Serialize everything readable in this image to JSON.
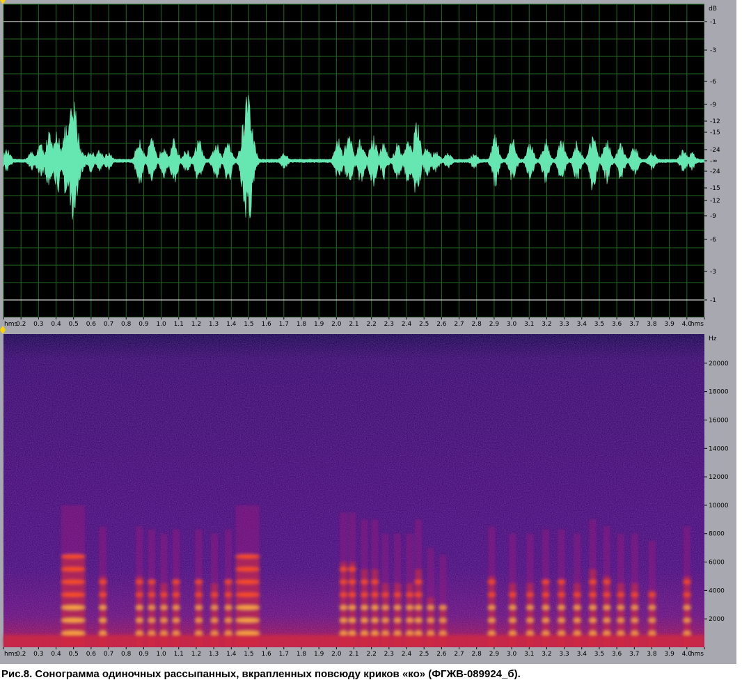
{
  "caption": "Рис.8. Сонограмма одиночных рассыпанных, вкрапленных повсюду криков «ко» (ФГЖВ-089924_б).",
  "colors": {
    "window_bg": "#a8a8b0",
    "waveform_bg": "#000000",
    "waveform_grid": "#1f6b1f",
    "waveform_line": "#66e6b0",
    "waveform_limit_line": "#ffffff",
    "ruler_bg": "#a8a8b0",
    "ruler_text": "#000000",
    "marker": "#ffd400"
  },
  "chart_data": [
    {
      "type": "line",
      "name": "waveform",
      "x_unit": "hms",
      "x_ticks": [
        "hms",
        "0.2",
        "0.3",
        "0.4",
        "0.5",
        "0.6",
        "0.7",
        "0.8",
        "0.9",
        "1.0",
        "1.1",
        "1.2",
        "1.3",
        "1.4",
        "1.5",
        "1.6",
        "1.7",
        "1.8",
        "1.9",
        "2.0",
        "2.1",
        "2.2",
        "2.3",
        "2.4",
        "2.5",
        "2.6",
        "2.7",
        "2.8",
        "2.9",
        "3.0",
        "3.1",
        "3.2",
        "3.3",
        "3.4",
        "3.5",
        "3.6",
        "3.7",
        "3.8",
        "3.9",
        "4.0",
        "hms"
      ],
      "y_unit": "dB",
      "y_ticks": [
        "-1",
        "-3",
        "-6",
        "-9",
        "-12",
        "-15",
        "-24",
        "-∞",
        "-24",
        "-15",
        "-12",
        "-9",
        "-6",
        "-3",
        "-1"
      ],
      "xlim": [
        0.1,
        4.12
      ],
      "grid": true,
      "envelope": [
        {
          "t": 0.12,
          "amp": 0.15
        },
        {
          "t": 0.26,
          "amp": 0.12
        },
        {
          "t": 0.31,
          "amp": 0.25
        },
        {
          "t": 0.36,
          "amp": 0.4
        },
        {
          "t": 0.41,
          "amp": 0.45
        },
        {
          "t": 0.46,
          "amp": 0.5
        },
        {
          "t": 0.5,
          "amp": 0.85
        },
        {
          "t": 0.55,
          "amp": 0.15
        },
        {
          "t": 0.6,
          "amp": 0.15
        },
        {
          "t": 0.65,
          "amp": 0.15
        },
        {
          "t": 0.7,
          "amp": 0.12
        },
        {
          "t": 0.88,
          "amp": 0.35
        },
        {
          "t": 0.95,
          "amp": 0.3
        },
        {
          "t": 1.02,
          "amp": 0.25
        },
        {
          "t": 1.08,
          "amp": 0.3
        },
        {
          "t": 1.15,
          "amp": 0.15
        },
        {
          "t": 1.22,
          "amp": 0.3
        },
        {
          "t": 1.32,
          "amp": 0.25
        },
        {
          "t": 1.39,
          "amp": 0.32
        },
        {
          "t": 1.5,
          "amp": 1.0
        },
        {
          "t": 1.71,
          "amp": 0.1
        },
        {
          "t": 2.02,
          "amp": 0.3
        },
        {
          "t": 2.08,
          "amp": 0.4
        },
        {
          "t": 2.15,
          "amp": 0.3
        },
        {
          "t": 2.22,
          "amp": 0.35
        },
        {
          "t": 2.28,
          "amp": 0.25
        },
        {
          "t": 2.36,
          "amp": 0.25
        },
        {
          "t": 2.42,
          "amp": 0.3
        },
        {
          "t": 2.47,
          "amp": 0.55
        },
        {
          "t": 2.53,
          "amp": 0.2
        },
        {
          "t": 2.58,
          "amp": 0.15
        },
        {
          "t": 2.65,
          "amp": 0.1
        },
        {
          "t": 2.8,
          "amp": 0.1
        },
        {
          "t": 2.92,
          "amp": 0.35
        },
        {
          "t": 3.02,
          "amp": 0.3
        },
        {
          "t": 3.12,
          "amp": 0.25
        },
        {
          "t": 3.21,
          "amp": 0.3
        },
        {
          "t": 3.3,
          "amp": 0.3
        },
        {
          "t": 3.39,
          "amp": 0.28
        },
        {
          "t": 3.48,
          "amp": 0.45
        },
        {
          "t": 3.56,
          "amp": 0.3
        },
        {
          "t": 3.64,
          "amp": 0.25
        },
        {
          "t": 3.72,
          "amp": 0.2
        },
        {
          "t": 3.82,
          "amp": 0.12
        },
        {
          "t": 4.0,
          "amp": 0.15
        },
        {
          "t": 4.05,
          "amp": 0.12
        }
      ]
    },
    {
      "type": "heatmap",
      "name": "spectrogram",
      "x_unit": "hms",
      "x_ticks": [
        "hms",
        "0.2",
        "0.3",
        "0.4",
        "0.5",
        "0.6",
        "0.7",
        "0.8",
        "0.9",
        "1.0",
        "1.1",
        "1.2",
        "1.3",
        "1.4",
        "1.5",
        "1.6",
        "1.7",
        "1.8",
        "1.9",
        "2.0",
        "2.1",
        "2.2",
        "2.3",
        "2.4",
        "2.5",
        "2.6",
        "2.7",
        "2.8",
        "2.9",
        "3.0",
        "3.1",
        "3.2",
        "3.3",
        "3.4",
        "3.5",
        "3.6",
        "3.7",
        "3.8",
        "3.9",
        "4.0",
        "hms"
      ],
      "y_unit": "Hz",
      "y_ticks": [
        "20000",
        "18000",
        "16000",
        "14000",
        "12000",
        "10000",
        "8000",
        "6000",
        "4000",
        "2000"
      ],
      "xlim": [
        0.1,
        4.12
      ],
      "ylim": [
        0,
        22050
      ],
      "colormap": [
        "#180a50",
        "#38106e",
        "#5a1482",
        "#9a1b7c",
        "#d42a3a",
        "#ff5020",
        "#ffb040",
        "#ffffb0"
      ],
      "calls": [
        {
          "t": 0.5,
          "band_top_hz": 6500,
          "intensity": 0.95
        },
        {
          "t": 0.67,
          "band_top_hz": 5000,
          "intensity": 0.75
        },
        {
          "t": 0.88,
          "band_top_hz": 5000,
          "intensity": 0.6
        },
        {
          "t": 0.95,
          "band_top_hz": 4800,
          "intensity": 0.55
        },
        {
          "t": 1.02,
          "band_top_hz": 4500,
          "intensity": 0.5
        },
        {
          "t": 1.09,
          "band_top_hz": 4800,
          "intensity": 0.55
        },
        {
          "t": 1.22,
          "band_top_hz": 4800,
          "intensity": 0.5
        },
        {
          "t": 1.31,
          "band_top_hz": 4500,
          "intensity": 0.5
        },
        {
          "t": 1.39,
          "band_top_hz": 4800,
          "intensity": 0.55
        },
        {
          "t": 1.5,
          "band_top_hz": 6500,
          "intensity": 0.9
        },
        {
          "t": 2.05,
          "band_top_hz": 6000,
          "intensity": 0.7
        },
        {
          "t": 2.1,
          "band_top_hz": 6000,
          "intensity": 0.75
        },
        {
          "t": 2.17,
          "band_top_hz": 5500,
          "intensity": 0.7
        },
        {
          "t": 2.23,
          "band_top_hz": 5500,
          "intensity": 0.75
        },
        {
          "t": 2.29,
          "band_top_hz": 4500,
          "intensity": 0.55
        },
        {
          "t": 2.36,
          "band_top_hz": 4500,
          "intensity": 0.6
        },
        {
          "t": 2.43,
          "band_top_hz": 4500,
          "intensity": 0.6
        },
        {
          "t": 2.48,
          "band_top_hz": 5500,
          "intensity": 0.7
        },
        {
          "t": 2.55,
          "band_top_hz": 3500,
          "intensity": 0.55
        },
        {
          "t": 2.62,
          "band_top_hz": 3000,
          "intensity": 0.5
        },
        {
          "t": 2.9,
          "band_top_hz": 5000,
          "intensity": 0.6
        },
        {
          "t": 3.02,
          "band_top_hz": 4500,
          "intensity": 0.65
        },
        {
          "t": 3.12,
          "band_top_hz": 4500,
          "intensity": 0.55
        },
        {
          "t": 3.21,
          "band_top_hz": 4800,
          "intensity": 0.6
        },
        {
          "t": 3.3,
          "band_top_hz": 4800,
          "intensity": 0.6
        },
        {
          "t": 3.39,
          "band_top_hz": 4500,
          "intensity": 0.6
        },
        {
          "t": 3.48,
          "band_top_hz": 5500,
          "intensity": 0.7
        },
        {
          "t": 3.56,
          "band_top_hz": 5000,
          "intensity": 0.6
        },
        {
          "t": 3.64,
          "band_top_hz": 4500,
          "intensity": 0.55
        },
        {
          "t": 3.72,
          "band_top_hz": 4500,
          "intensity": 0.55
        },
        {
          "t": 3.82,
          "band_top_hz": 4000,
          "intensity": 0.5
        },
        {
          "t": 4.02,
          "band_top_hz": 5000,
          "intensity": 0.55
        }
      ]
    }
  ]
}
